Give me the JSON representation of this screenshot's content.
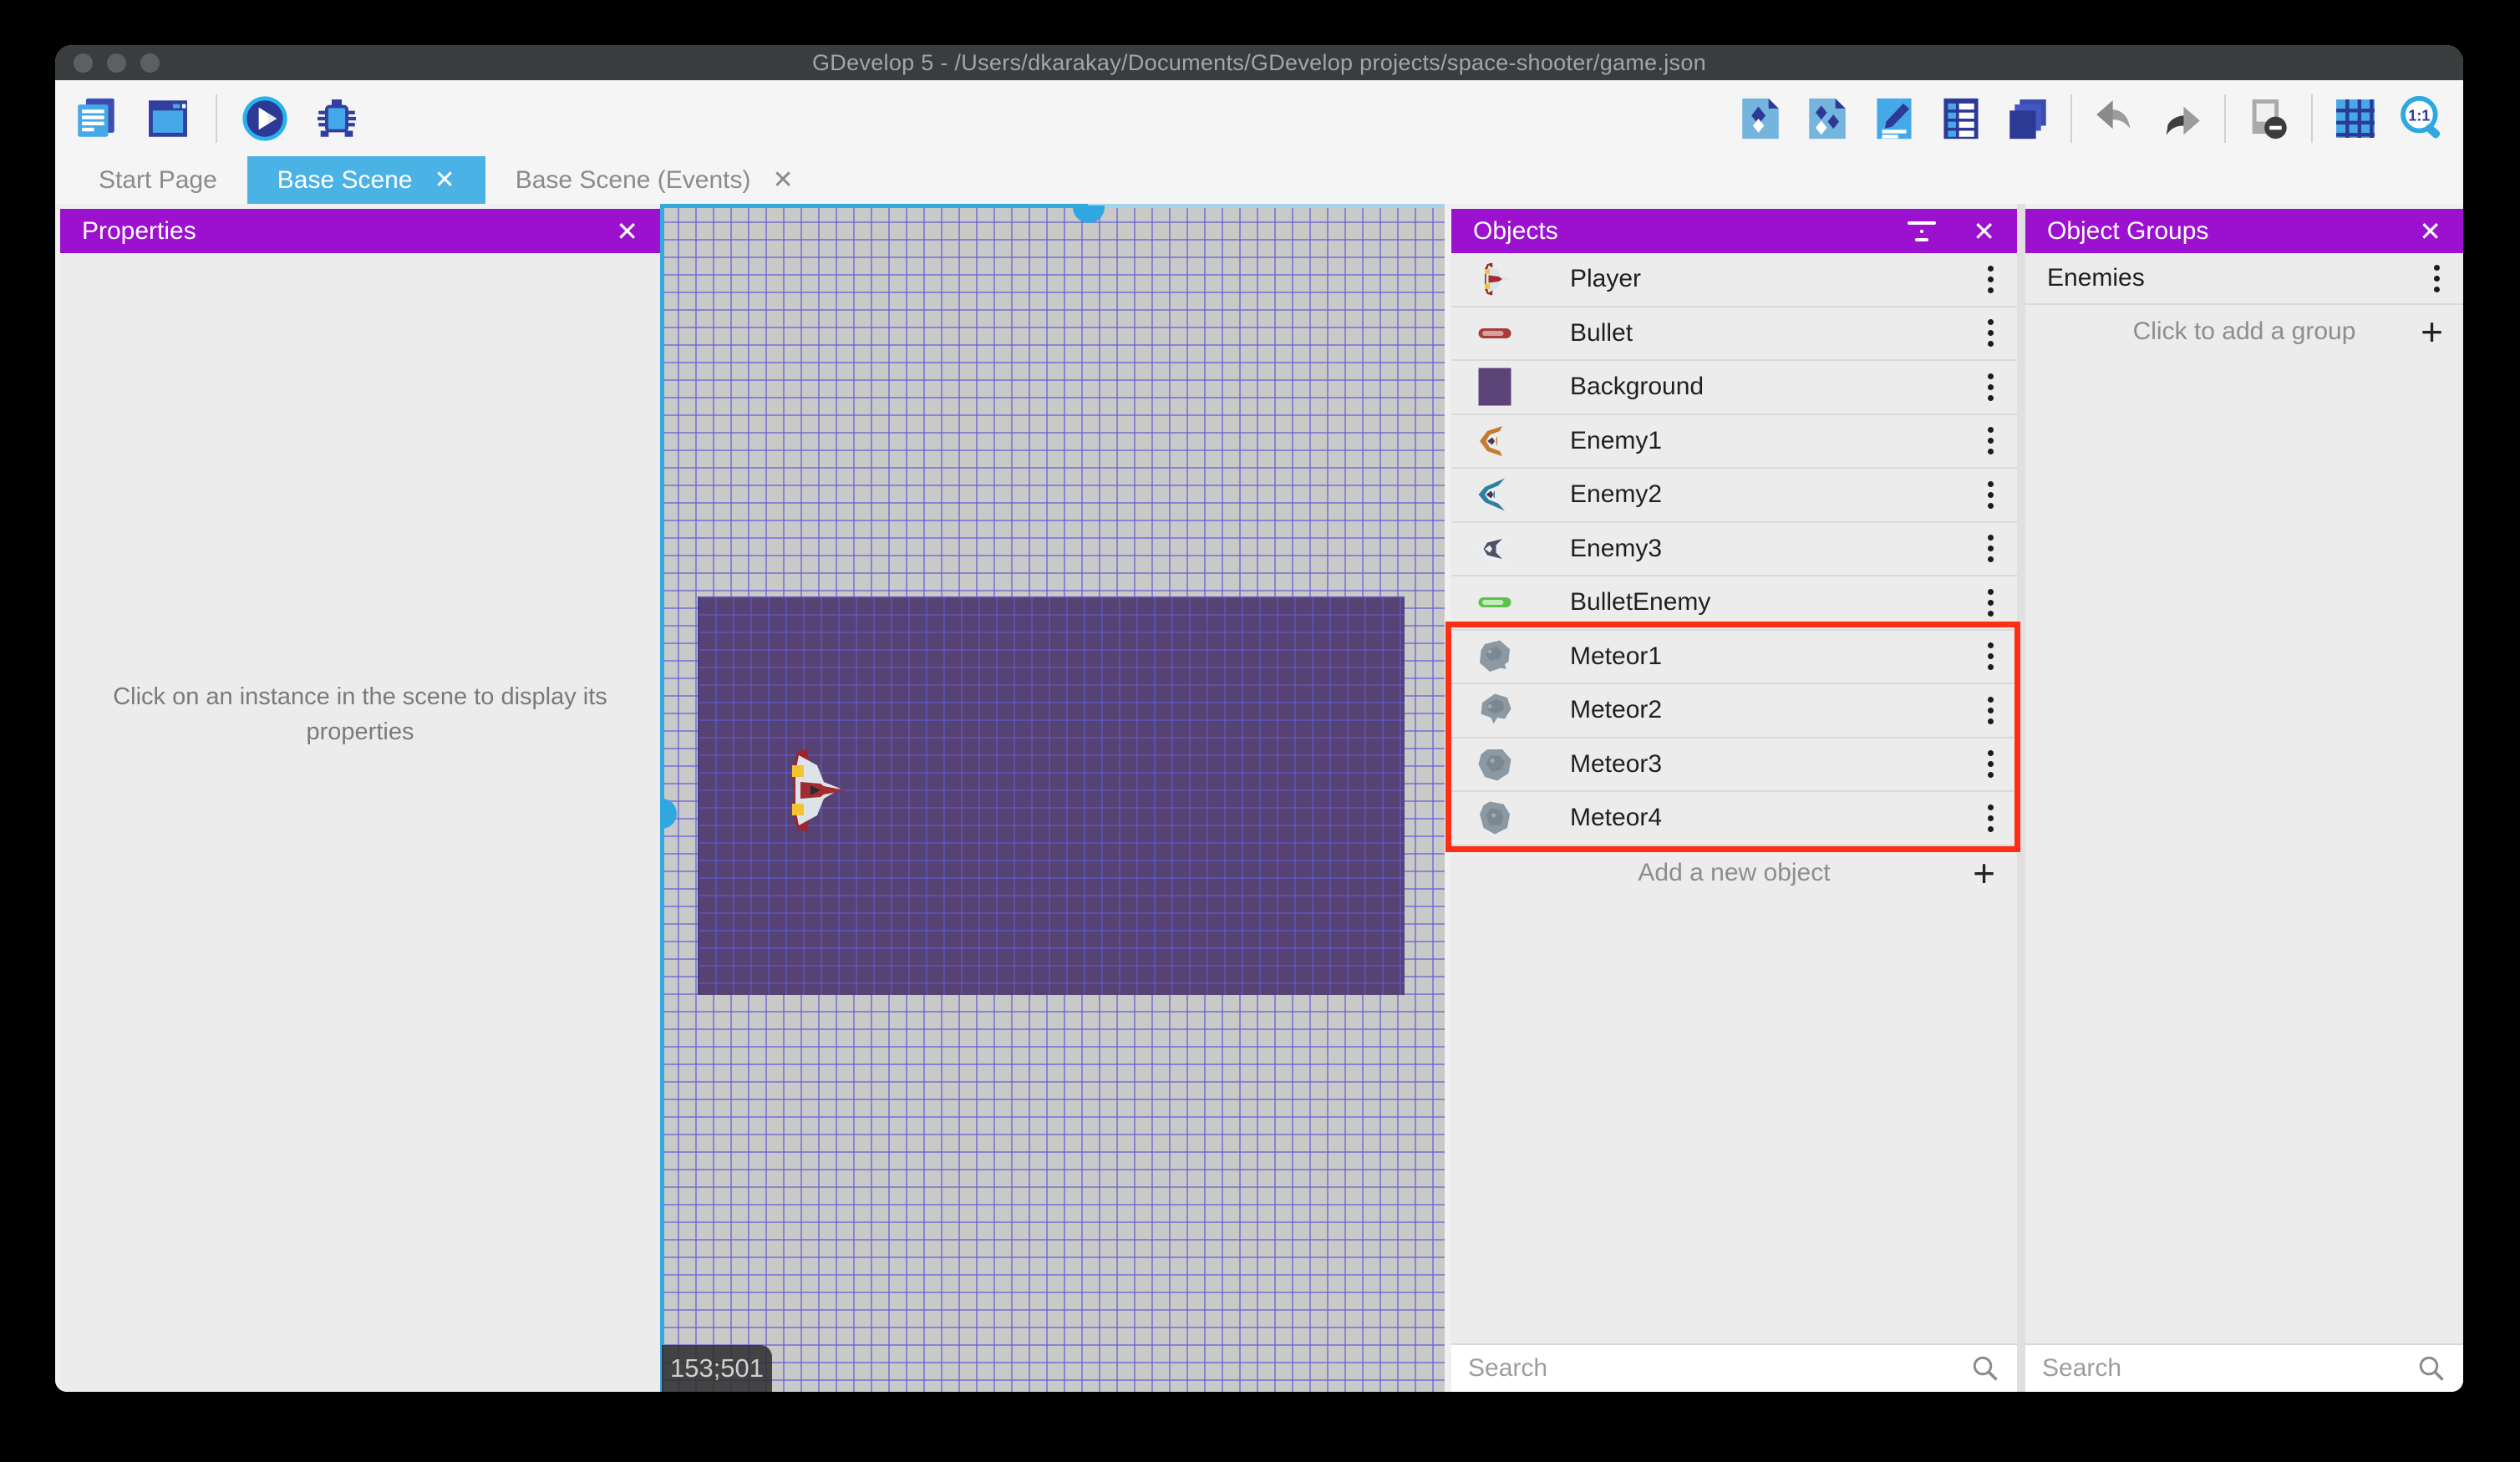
{
  "window": {
    "title": "GDevelop 5 - /Users/dkarakay/Documents/GDevelop projects/space-shooter/game.json"
  },
  "tabs": [
    {
      "label": "Start Page",
      "closable": false,
      "active": false
    },
    {
      "label": "Base Scene",
      "closable": true,
      "active": true
    },
    {
      "label": "Base Scene (Events)",
      "closable": true,
      "active": false
    }
  ],
  "icons": {
    "close": "✕",
    "plus": "+",
    "zoom_ratio": "1:1"
  },
  "properties_panel": {
    "title": "Properties",
    "empty_message": "Click on an instance in the scene to display its properties"
  },
  "scene": {
    "cursor_position": "153;501"
  },
  "objects_panel": {
    "title": "Objects",
    "items": [
      "Player",
      "Bullet",
      "Background",
      "Enemy1",
      "Enemy2",
      "Enemy3",
      "BulletEnemy",
      "Meteor1",
      "Meteor2",
      "Meteor3",
      "Meteor4"
    ],
    "highlighted_items": [
      "Meteor1",
      "Meteor2",
      "Meteor3",
      "Meteor4"
    ],
    "add_label": "Add a new object",
    "search_placeholder": "Search"
  },
  "object_groups_panel": {
    "title": "Object Groups",
    "groups": [
      "Enemies"
    ],
    "add_label": "Click to add a group",
    "search_placeholder": "Search"
  },
  "colors": {
    "panel_header": "#9b11cf",
    "active_tab": "#4bb2e6",
    "highlight_border": "#fe2e12",
    "selection": "#33a9e2",
    "titlebar": "#3a3d3e"
  }
}
